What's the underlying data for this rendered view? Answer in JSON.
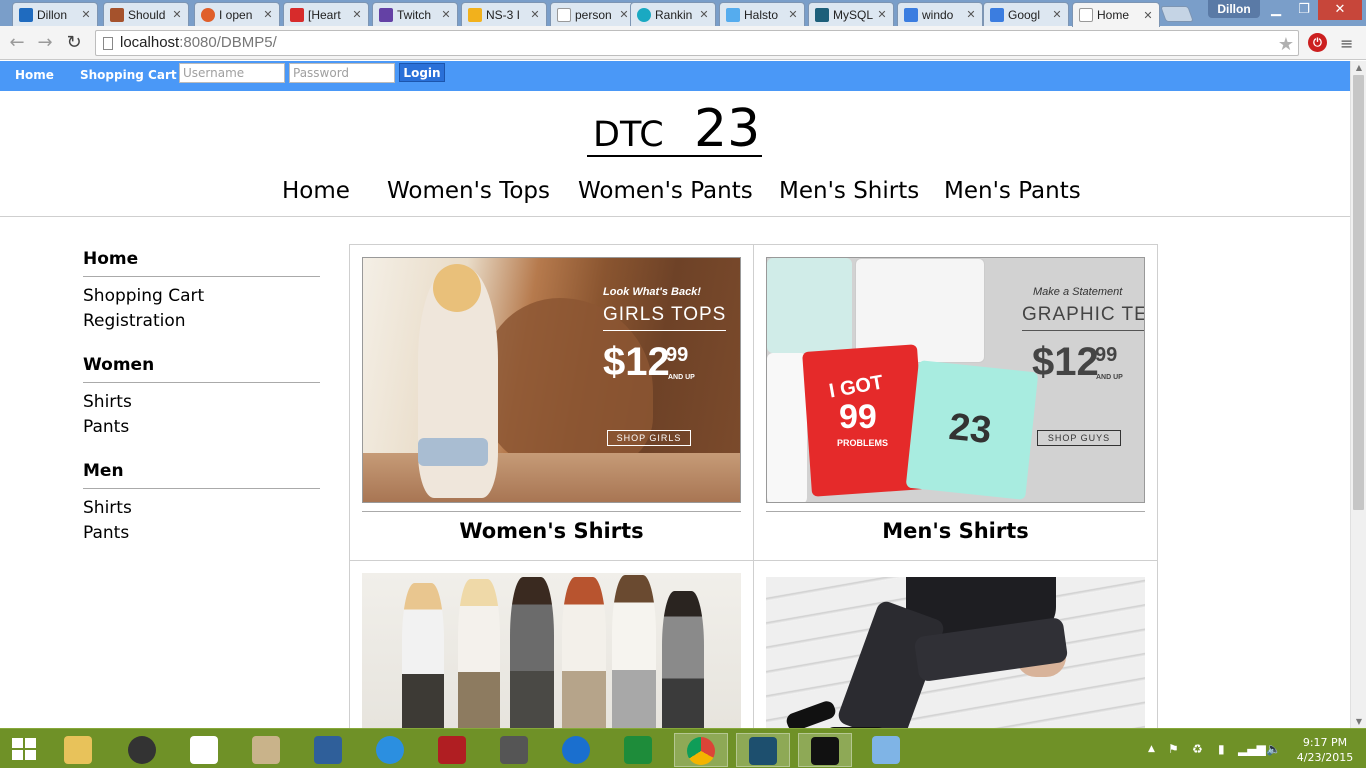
{
  "browser": {
    "tabs": [
      {
        "label": "Dillon",
        "color": "#1f6bbf"
      },
      {
        "label": "Should",
        "color": "#a5522c"
      },
      {
        "label": "I open",
        "color": "#e05f2a"
      },
      {
        "label": "[Heart",
        "color": "#d72b2b"
      },
      {
        "label": "Twitch",
        "color": "#6441a5"
      },
      {
        "label": "NS-3 I",
        "color": "#f2b11c"
      },
      {
        "label": "person",
        "color": "#ffffff"
      },
      {
        "label": "Rankin",
        "color": "#1aa9c2"
      },
      {
        "label": "Halsto",
        "color": "#55acee"
      },
      {
        "label": "MySQL",
        "color": "#1d5f7a"
      },
      {
        "label": "windo",
        "color": "#3b7de0"
      },
      {
        "label": "Googl",
        "color": "#3b7de0"
      },
      {
        "label": "Home",
        "color": "#ffffff"
      }
    ],
    "profile_name": "Dillon",
    "address_host": "localhost",
    "address_path": ":8080/DBMP5/",
    "icons": {
      "back": "arrow-left-icon",
      "forward": "arrow-right-icon",
      "reload": "reload-icon",
      "bookmark": "star-icon",
      "menu": "hamburger-menu-icon",
      "extension": "power-extension-icon"
    }
  },
  "site": {
    "topbar": {
      "home": "Home",
      "cart": "Shopping Cart",
      "username_placeholder": "Username",
      "password_placeholder": "Password",
      "login": "Login",
      "color": "#4a98f7"
    },
    "logo": {
      "part1": "DTC",
      "part2": "23"
    },
    "nav": [
      "Home",
      "Women's Tops",
      "Women's Pants",
      "Men's Shirts",
      "Men's Pants"
    ],
    "sidebar": [
      {
        "heading": "Home",
        "items": [
          "Shopping Cart",
          "Registration"
        ]
      },
      {
        "heading": "Women",
        "items": [
          "Shirts",
          "Pants"
        ]
      },
      {
        "heading": "Men",
        "items": [
          "Shirts",
          "Pants"
        ]
      }
    ],
    "products": [
      {
        "caption": "Women's Shirts",
        "banner": {
          "tagline": "Look What's Back!",
          "title": "GIRLS TOPS",
          "dollars": "$12",
          "cents": "99",
          "suffix": "AND UP",
          "cta": "SHOP GIRLS"
        }
      },
      {
        "caption": "Men's Shirts",
        "banner": {
          "tagline": "Make a Statement",
          "title": "GRAPHIC TEES",
          "dollars": "$12",
          "cents": "99",
          "suffix": "AND UP",
          "cta": "SHOP GUYS",
          "tee1": "I GOT",
          "tee2": "99",
          "tee3": "PROBLEMS",
          "tee4": "23"
        }
      }
    ]
  },
  "taskbar": {
    "apps": [
      "file-explorer-icon",
      "speaker-app-icon",
      "amazon-icon",
      "settings-app-icon",
      "control-panel-icon",
      "internet-explorer-icon",
      "power-app-icon",
      "document-app-icon",
      "sync-app-icon",
      "excel-icon",
      "chrome-icon",
      "mysql-workbench-icon",
      "mysql-console-icon",
      "virtualbox-icon"
    ],
    "time": "9:17 PM",
    "date": "4/23/2015",
    "color": "#6f9127"
  }
}
